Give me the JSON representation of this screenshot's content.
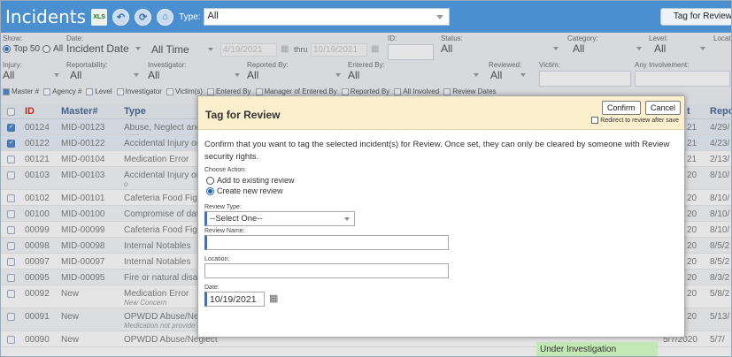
{
  "topbar": {
    "title": "Incidents",
    "type_label": "Type:",
    "type_value": "All",
    "tag_button": "Tag for Review"
  },
  "filters": {
    "show_label": "Show:",
    "top50": "Top 50",
    "all": "All",
    "date_label": "Date:",
    "date_field": "Incident Date",
    "date_range": "All Time",
    "date_from": "4/19/2021",
    "thru": "thru",
    "date_to": "10/19/2021",
    "id_label": "ID:",
    "status_label": "Status:",
    "status_value": "All",
    "category_label": "Category:",
    "category_value": "All",
    "level_label": "Level:",
    "level_value": "All",
    "location_label": "Locati",
    "injury_label": "Injury:",
    "injury_value": "All",
    "reportability_label": "Reportability:",
    "reportability_value": "All",
    "investigator_label": "Investigator:",
    "investigator_value": "All",
    "reported_by_label": "Reported By:",
    "reported_by_value": "All",
    "entered_by_label": "Entered By:",
    "entered_by_value": "All",
    "reviewed_label": "Reviewed:",
    "reviewed_value": "All",
    "victim_label": "Victim:",
    "involvement_label": "Any Involvement:",
    "columns": [
      "Master #",
      "Agency #",
      "Level",
      "Investigator",
      "Victim(s)",
      "Entered By",
      "Manager of Entered By",
      "Reported By",
      "All Involved",
      "Review Dates"
    ]
  },
  "grid": {
    "headers": {
      "id": "ID",
      "master": "Master#",
      "type": "Type",
      "col_t": "t",
      "report": "Repo"
    },
    "rows": [
      {
        "id": "00124",
        "master": "MID-00123",
        "type": "Abuse, Neglect and/",
        "sub": "aaaa",
        "t": "21",
        "rep": "4/29/",
        "checked": true
      },
      {
        "id": "00122",
        "master": "MID-00122",
        "type": "Accidental Injury or I",
        "sub": "",
        "t": "21",
        "rep": "4/23/",
        "checked": true
      },
      {
        "id": "00121",
        "master": "MID-00104",
        "type": "Medication Error",
        "sub": "",
        "t": "21",
        "rep": "2/13/",
        "checked": false
      },
      {
        "id": "00103",
        "master": "MID-00103",
        "type": "Accidental Injury or I",
        "sub": "o",
        "t": "20",
        "rep": "8/10/",
        "checked": false
      },
      {
        "id": "00102",
        "master": "MID-00101",
        "type": "Cafeteria Food Fight",
        "sub": "",
        "t": "20",
        "rep": "8/10/",
        "checked": false
      },
      {
        "id": "00100",
        "master": "MID-00100",
        "type": "Compromise of date",
        "sub": "",
        "t": "20",
        "rep": "8/10/",
        "checked": false
      },
      {
        "id": "00099",
        "master": "MID-00099",
        "type": "Cafeteria Food Fight",
        "sub": "",
        "t": "20",
        "rep": "8/10/",
        "checked": false
      },
      {
        "id": "00098",
        "master": "MID-00098",
        "type": "Internal Notables",
        "sub": "",
        "t": "20",
        "rep": "8/5/2",
        "checked": false
      },
      {
        "id": "00097",
        "master": "MID-00097",
        "type": "Internal Notables",
        "sub": "",
        "t": "20",
        "rep": "8/5/2",
        "checked": false
      },
      {
        "id": "00095",
        "master": "MID-00095",
        "type": "Fire or natural disaste",
        "sub": "",
        "t": "20",
        "rep": "8/3/2",
        "checked": false
      },
      {
        "id": "00092",
        "master": "New",
        "type": "Medication Error",
        "sub": "New Concern",
        "t": "20",
        "rep": "5/8/2",
        "checked": false
      },
      {
        "id": "00091",
        "master": "New",
        "type": "OPWDD Abuse/Negle",
        "sub": "Medication not provide",
        "t": "20",
        "rep": "5/13/",
        "checked": false
      },
      {
        "id": "00090",
        "master": "New",
        "type": "OPWDD Abuse/Neglect",
        "sub": "",
        "t": "5/7/2020",
        "rep": "5/7/",
        "checked": false
      }
    ],
    "status_cell": "Under Investigation"
  },
  "modal": {
    "title": "Tag for Review",
    "confirm": "Confirm",
    "cancel": "Cancel",
    "redirect": "Redirect to review after save",
    "message": "Confirm that you want to tag the selected incident(s) for Review. Once set, they can only be cleared by someone with Review security rights.",
    "choose_action": "Choose Action:",
    "add_existing": "Add to existing review",
    "create_new": "Create new review",
    "review_type_label": "Review Type:",
    "review_type_value": "--Select One--",
    "review_name_label": "Review Name:",
    "location_label": "Location:",
    "date_label": "Date:",
    "date_value": "10/19/2021"
  },
  "colors": {
    "topbar": "#4a8fd0",
    "modal_header": "#fcefcd",
    "status": "#c4e7b6"
  }
}
